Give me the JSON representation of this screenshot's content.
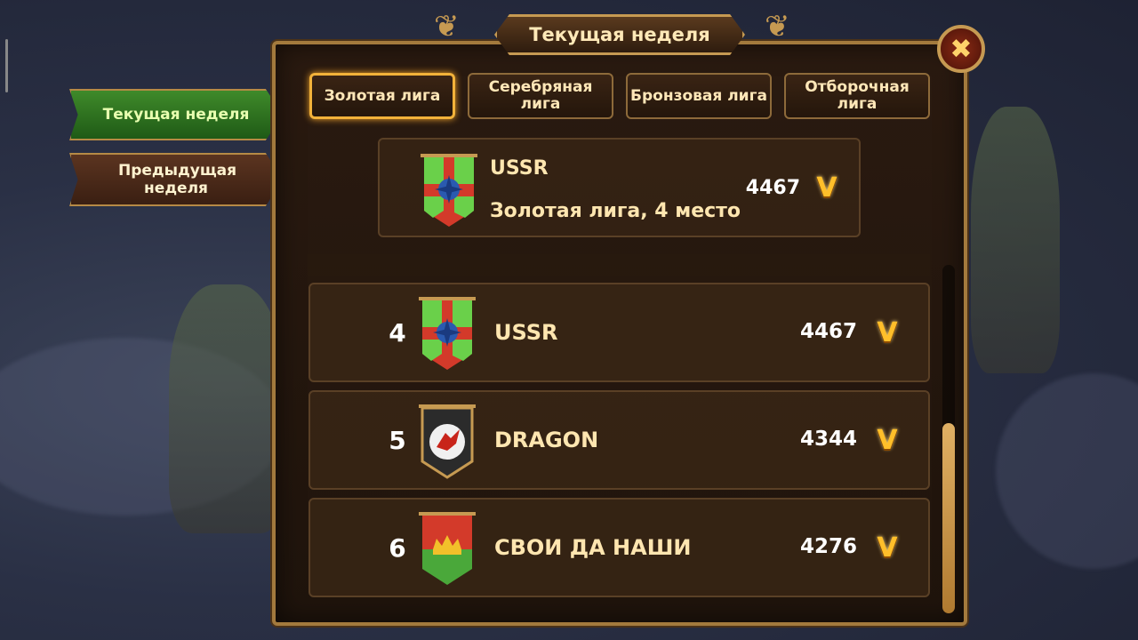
{
  "side_tabs": [
    {
      "label": "Текущая неделя"
    },
    {
      "label": "Предыдущая неделя"
    }
  ],
  "panel": {
    "title": "Текущая неделя"
  },
  "league_tabs": [
    {
      "label": "Золотая лига"
    },
    {
      "label": "Серебряная лига"
    },
    {
      "label": "Бронзовая лига"
    },
    {
      "label": "Отборочная лига"
    }
  ],
  "my_guild": {
    "name": "USSR",
    "subtitle": "Золотая лига, 4 место",
    "score": "4467",
    "score_icon": "v-wings-icon"
  },
  "rows": [
    {
      "rank": "4",
      "name": "USSR",
      "score": "4467",
      "banner": "green-red-star-banner"
    },
    {
      "rank": "5",
      "name": "DRAGON",
      "score": "4344",
      "banner": "black-dragon-banner"
    },
    {
      "rank": "6",
      "name": "СВОИ ДА НАШИ",
      "score": "4276",
      "banner": "red-green-crown-banner"
    }
  ],
  "close_icon": "close-icon",
  "colors": {
    "accent_gold": "#c69a52",
    "active_tab_green": "#3f8a2a",
    "score_icon_gold": "#ffbf2a"
  }
}
